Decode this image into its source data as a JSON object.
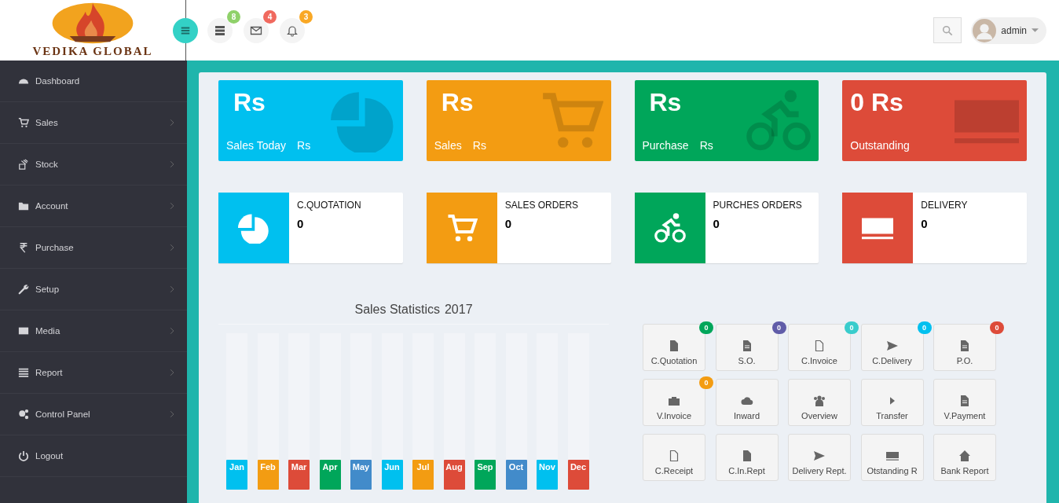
{
  "logo": {
    "text": "VEDIKA GLOBAL"
  },
  "header": {
    "icon_buttons": [
      {
        "badge": "8",
        "color": "#8fd16a"
      },
      {
        "badge": "4",
        "color": "#f0695e"
      },
      {
        "badge": "3",
        "color": "#f9a825"
      }
    ],
    "user": {
      "name": "admin"
    }
  },
  "sidebar": {
    "items": [
      {
        "label": "Dashboard",
        "submenu": false
      },
      {
        "label": "Sales",
        "submenu": true
      },
      {
        "label": "Stock",
        "submenu": true
      },
      {
        "label": "Account",
        "submenu": true
      },
      {
        "label": "Purchase",
        "submenu": true
      },
      {
        "label": "Setup",
        "submenu": true
      },
      {
        "label": "Media",
        "submenu": true
      },
      {
        "label": "Report",
        "submenu": true
      },
      {
        "label": "Control Panel",
        "submenu": true
      },
      {
        "label": "Logout",
        "submenu": false
      }
    ]
  },
  "stat_cards": [
    {
      "value": "Rs",
      "label": "Sales Today",
      "amount": "Rs",
      "color": "#00c0ef"
    },
    {
      "value": "Rs",
      "label": "Sales",
      "amount": "Rs",
      "color": "#f39c12"
    },
    {
      "value": "Rs",
      "label": "Purchase",
      "amount": "Rs",
      "color": "#00a65a"
    },
    {
      "value": "0 Rs",
      "label": "Outstanding",
      "color": "#dd4b39"
    }
  ],
  "info_boxes": [
    {
      "label": "C.QUOTATION",
      "value": "0",
      "color": "#00c0ef"
    },
    {
      "label": "SALES ORDERS",
      "value": "0",
      "color": "#f39c12"
    },
    {
      "label": "PURCHES ORDERS",
      "value": "0",
      "color": "#00a65a"
    },
    {
      "label": "DELIVERY",
      "value": "0",
      "color": "#dd4b39"
    }
  ],
  "sales_statistics": {
    "title": "Sales Statistics",
    "year": "2017",
    "months": [
      {
        "label": "Jan",
        "color": "#00c0ef"
      },
      {
        "label": "Feb",
        "color": "#f39c12"
      },
      {
        "label": "Mar",
        "color": "#dd4b39"
      },
      {
        "label": "Apr",
        "color": "#00a65a"
      },
      {
        "label": "May",
        "color": "#428bca"
      },
      {
        "label": "Jun",
        "color": "#00c0ef"
      },
      {
        "label": "Jul",
        "color": "#f39c12"
      },
      {
        "label": "Aug",
        "color": "#dd4b39"
      },
      {
        "label": "Sep",
        "color": "#00a65a"
      },
      {
        "label": "Oct",
        "color": "#428bca"
      },
      {
        "label": "Nov",
        "color": "#00c0ef"
      },
      {
        "label": "Dec",
        "color": "#dd4b39"
      }
    ]
  },
  "shortcuts": [
    {
      "label": "C.Quotation",
      "badge": {
        "text": "0",
        "color": "#00a65a"
      }
    },
    {
      "label": "S.O.",
      "badge": {
        "text": "0",
        "color": "#605ca8"
      }
    },
    {
      "label": "C.Invoice",
      "badge": {
        "text": "0",
        "color": "#39cccc"
      }
    },
    {
      "label": "C.Delivery",
      "badge": {
        "text": "0",
        "color": "#00c0ef"
      }
    },
    {
      "label": "P.O.",
      "badge": {
        "text": "0",
        "color": "#dd4b39"
      }
    },
    {
      "label": "V.Invoice",
      "badge": {
        "text": "0",
        "color": "#f39c12"
      }
    },
    {
      "label": "Inward"
    },
    {
      "label": "Overview"
    },
    {
      "label": "Transfer"
    },
    {
      "label": "V.Payment"
    },
    {
      "label": "C.Receipt"
    },
    {
      "label": "C.In.Rept"
    },
    {
      "label": "Delivery Rept."
    },
    {
      "label": "Otstanding R"
    },
    {
      "label": "Bank Report"
    }
  ]
}
